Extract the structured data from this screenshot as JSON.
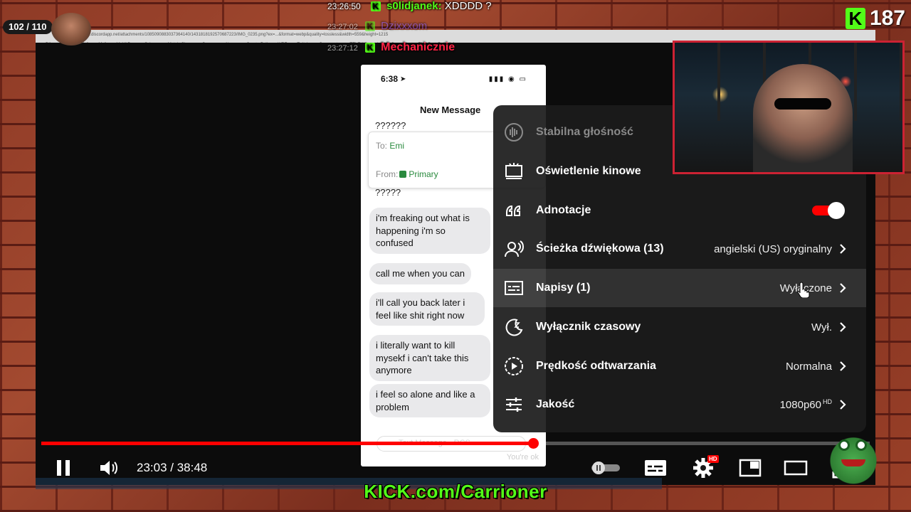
{
  "overlay": {
    "sub_goal": "102 / 110",
    "chat": [
      {
        "time": "23:26:50",
        "user": "s0lidjanek",
        "msg": "XDDDD ?"
      },
      {
        "time": "23:27:02",
        "user": "Dzixxxom",
        "msg": ""
      },
      {
        "time": "23:27:12",
        "user": "Mechanicznie",
        "msg": ""
      }
    ],
    "viewer_icon": "K",
    "viewer_count": "187",
    "kick_url": "KICK.com/Carrioner"
  },
  "browser": {
    "url": "media.discordapp.net/attachments/1085090883037364140/1431818192570687223/IMG_0235.png?ex=...&format=webp&quality=lossless&width=559&height=1215",
    "bookmarks": [
      "Dijo",
      "Mail",
      "Mail",
      "Mail",
      "Mobil Browser Sche...",
      "Meta's Show",
      "Games",
      "News",
      "Create Poll",
      "WPF",
      "Twitch",
      "Comments",
      "TELEKIS",
      "Legion Song 4th",
      "TNS Best Rails & Ar..."
    ]
  },
  "phone": {
    "time": "6:38",
    "status_icons": "▮▮▮ ◉ ▭",
    "title": "New Message",
    "q1": "??????",
    "to_label": "To:",
    "to_value": "Emi",
    "from_label": "From:",
    "from_value": "Primary",
    "q2": "?????",
    "messages": [
      "i'm freaking out what is happening i'm so confused",
      "call me when you can",
      "i'll call you back later i feel like shit right now",
      "i literally want to kill mysekf i can't take this anymore",
      "i feel so alone and like a problem"
    ],
    "compose_placeholder": "Text Message · RCS",
    "ok_preview": "You're ok"
  },
  "settings_menu": {
    "items": [
      {
        "label": "Stabilna głośność",
        "value": "",
        "icon": "stable-volume-icon",
        "disabled": true
      },
      {
        "label": "Oświetlenie kinowe",
        "value": "",
        "icon": "ambient-mode-icon"
      },
      {
        "label": "Adnotacje",
        "value": "",
        "icon": "annotations-icon",
        "toggle": true
      },
      {
        "label": "Ścieżka dźwiękowa (13)",
        "value": "angielski (US) oryginalny",
        "icon": "audio-track-icon"
      },
      {
        "label": "Napisy (1)",
        "value": "Wyłączone",
        "icon": "subtitles-icon"
      },
      {
        "label": "Wyłącznik czasowy",
        "value": "Wył.",
        "icon": "sleep-timer-icon"
      },
      {
        "label": "Prędkość odtwarzania",
        "value": "Normalna",
        "icon": "playback-speed-icon"
      },
      {
        "label": "Jakość",
        "value": "1080p60",
        "badge": "HD",
        "icon": "quality-icon"
      }
    ]
  },
  "player": {
    "current_time": "23:03",
    "separator": " / ",
    "duration": "38:48",
    "progress_fraction": 0.594,
    "hd_badge": "HD"
  },
  "colors": {
    "kick_green": "#53fc18",
    "youtube_red": "#ff0000",
    "menu_bg": "#1c1c1c"
  }
}
